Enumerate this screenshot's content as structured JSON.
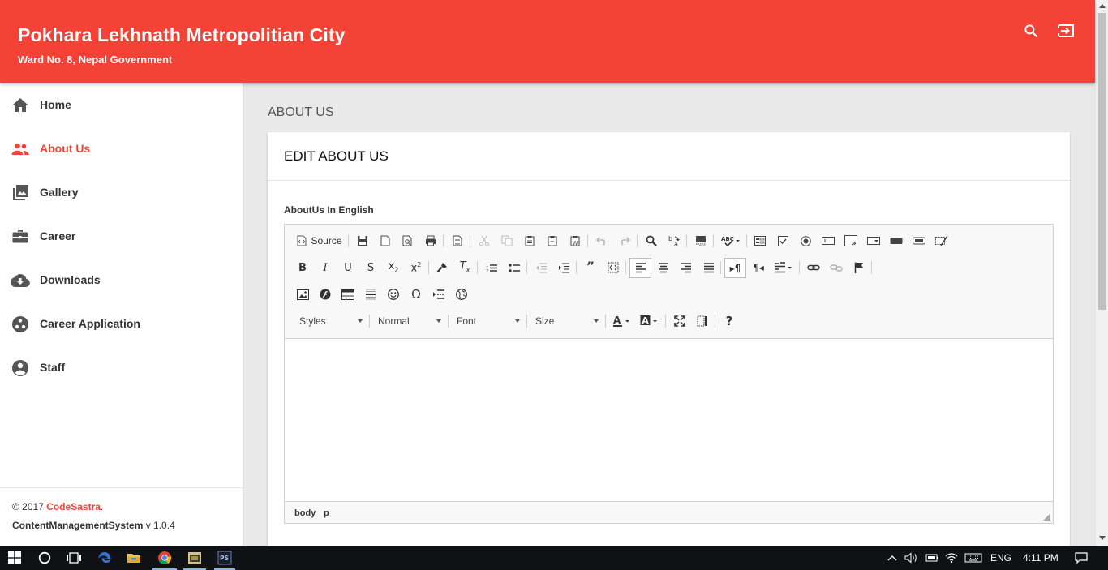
{
  "header": {
    "title": "Pokhara Lekhnath Metropolitian City",
    "subtitle": "Ward No. 8, Nepal Government",
    "icons": [
      "search-icon",
      "logout-icon"
    ]
  },
  "sidebar": {
    "items": [
      {
        "label": "Home",
        "icon": "home-icon",
        "active": false
      },
      {
        "label": "About Us",
        "icon": "people-icon",
        "active": true
      },
      {
        "label": "Gallery",
        "icon": "photo-library-icon",
        "active": false
      },
      {
        "label": "Career",
        "icon": "briefcase-icon",
        "active": false
      },
      {
        "label": "Downloads",
        "icon": "cloud-download-icon",
        "active": false
      },
      {
        "label": "Career Application",
        "icon": "group-work-icon",
        "active": false
      },
      {
        "label": "Staff",
        "icon": "account-circle-icon",
        "active": false
      }
    ],
    "footer": {
      "copyright": "© 2017",
      "brand": "CodeSastra",
      "period": ".",
      "system": "ContentManagementSystem",
      "version": "v 1.0.4"
    }
  },
  "main": {
    "page_title": "ABOUT US",
    "card_title": "EDIT ABOUT US",
    "field_label": "AboutUs In English"
  },
  "editor": {
    "source_label": "Source",
    "combos": {
      "styles": "Styles",
      "format": "Normal",
      "font": "Font",
      "size": "Size"
    },
    "path": [
      "body",
      "p"
    ],
    "content": ""
  },
  "taskbar": {
    "language": "ENG",
    "time": "4:11 PM"
  },
  "colors": {
    "primary": "#f44336",
    "taskbar": "#101114",
    "background": "#e9e9e9"
  }
}
